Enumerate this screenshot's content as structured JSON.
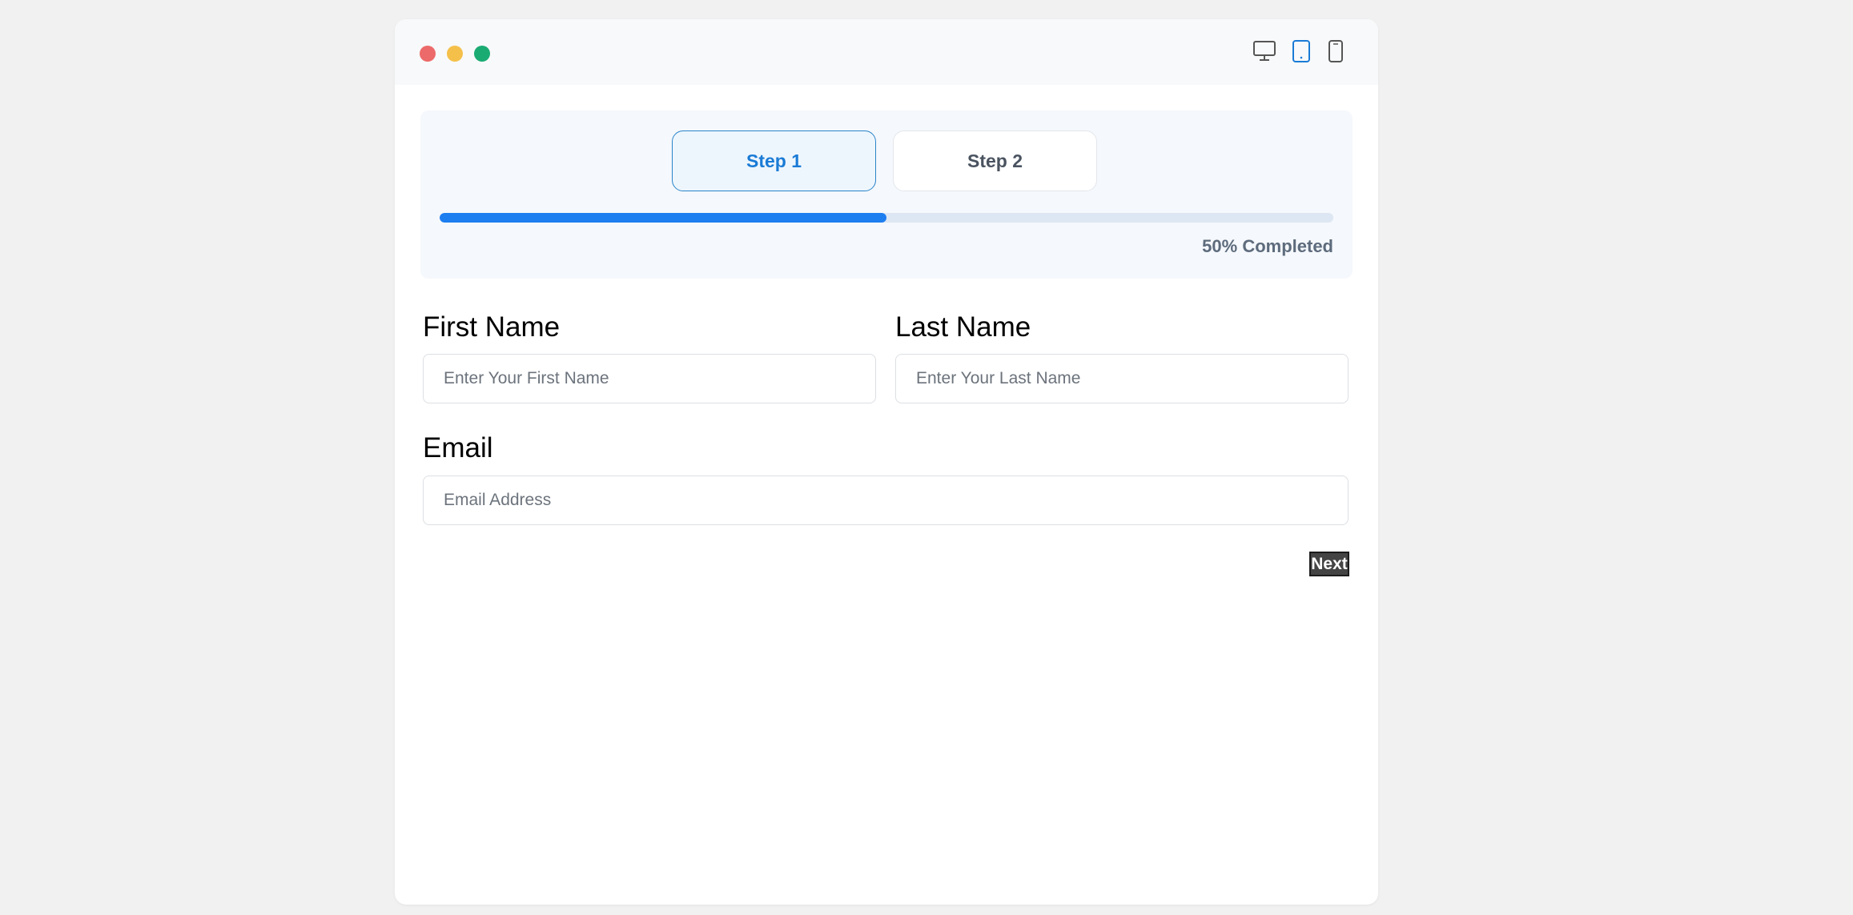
{
  "window": {
    "controls": [
      {
        "name": "close",
        "color": "#ec6a6a"
      },
      {
        "name": "minimize",
        "color": "#f5c04a"
      },
      {
        "name": "maximize",
        "color": "#1aab73"
      }
    ],
    "device_toggles": [
      {
        "icon": "desktop-icon",
        "active": false
      },
      {
        "icon": "tablet-icon",
        "active": true
      },
      {
        "icon": "mobile-icon",
        "active": false
      }
    ]
  },
  "stepper": {
    "steps": [
      {
        "label": "Step 1",
        "active": true
      },
      {
        "label": "Step 2",
        "active": false
      }
    ],
    "progress_percent": 50,
    "progress_label": "50% Completed",
    "accent_color": "#1d7ef0"
  },
  "form": {
    "first_name": {
      "label": "First Name",
      "placeholder": "Enter Your First Name",
      "value": ""
    },
    "last_name": {
      "label": "Last Name",
      "placeholder": "Enter Your Last Name",
      "value": ""
    },
    "email": {
      "label": "Email",
      "placeholder": "Email Address",
      "value": ""
    },
    "next_label": "Next"
  }
}
